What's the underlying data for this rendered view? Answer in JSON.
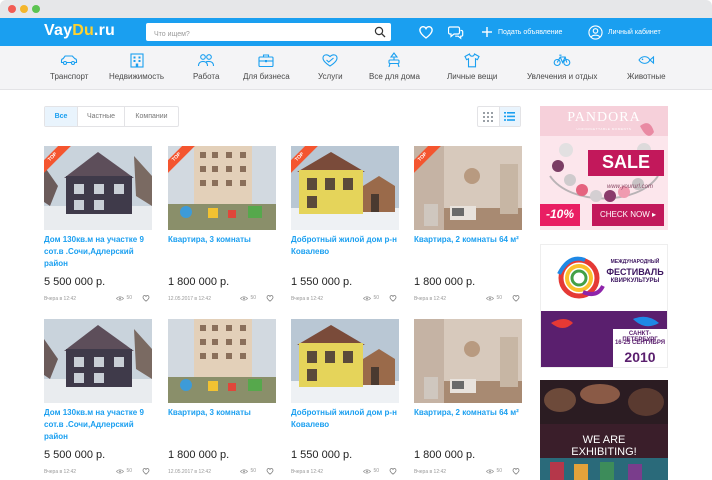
{
  "header": {
    "logo_a": "Vay",
    "logo_b": "Du",
    "logo_c": ".ru",
    "search_placeholder": "Что ищем?",
    "post_ad": "Подать объявление",
    "account": "Личный кабинет"
  },
  "categories": [
    {
      "label": "Транспорт",
      "icon": "car-icon"
    },
    {
      "label": "Недвижимость",
      "icon": "building-icon"
    },
    {
      "label": "Работа",
      "icon": "people-icon"
    },
    {
      "label": "Для бизнеса",
      "icon": "briefcase-icon"
    },
    {
      "label": "Услуги",
      "icon": "handshake-icon"
    },
    {
      "label": "Все для дома",
      "icon": "lamp-chair-icon"
    },
    {
      "label": "Личные вещи",
      "icon": "tshirt-icon"
    },
    {
      "label": "Увлечения и отдых",
      "icon": "bicycle-icon"
    },
    {
      "label": "Животные",
      "icon": "fish-icon"
    }
  ],
  "filters": [
    "Все",
    "Частные",
    "Компании"
  ],
  "listings": [
    {
      "title": "Дом 130кв.м на участке 9 сот.в .Сочи,Адлерский район",
      "price": "5 500 000 р.",
      "date": "Вчера в 12:42",
      "views": "50",
      "top": "TOP",
      "photo": "house"
    },
    {
      "title": "Квартира, 3 комнаты",
      "price": "1 800 000 р.",
      "date": "12.05.2017 в 12:42",
      "views": "50",
      "top": "TOP",
      "photo": "block"
    },
    {
      "title": "Добротный жилой дом р-н Ковалево",
      "price": "1 550 000 р.",
      "date": "Вчера в 12:42",
      "views": "50",
      "top": "TOP",
      "photo": "yellow"
    },
    {
      "title": "Квартира, 2 комнаты 64 м²",
      "price": "1 800 000 р.",
      "date": "Вчера в 12:42",
      "views": "50",
      "top": "TOP",
      "photo": "room"
    },
    {
      "title": "Дом 130кв.м на участке 9 сот.в .Сочи,Адлерский район",
      "price": "5 500 000 р.",
      "date": "Вчера в 12:42",
      "views": "50",
      "top": "",
      "photo": "house"
    },
    {
      "title": "Квартира, 3 комнаты",
      "price": "1 800 000 р.",
      "date": "12.05.2017 в 12:42",
      "views": "50",
      "top": "",
      "photo": "block"
    },
    {
      "title": "Добротный жилой дом р-н Ковалево",
      "price": "1 550 000 р.",
      "date": "Вчера в 12:42",
      "views": "50",
      "top": "",
      "photo": "yellow"
    },
    {
      "title": "Квартира, 2 комнаты 64 м²",
      "price": "1 800 000 р.",
      "date": "Вчера в 12:42",
      "views": "50",
      "top": "",
      "photo": "room"
    }
  ],
  "ads": {
    "pandora": {
      "brand": "PANDORA",
      "tagline": "UNFORGETTABLE MOMENTS",
      "sale": "SALE",
      "url": "www.yourur!.com",
      "discount": "-10%",
      "cta": "CHECK NOW ▸"
    },
    "festival": {
      "line1": "МЕЖДУНАРОДНЫЙ",
      "line2": "ФЕСТИВАЛЬ",
      "line3": "КВИРКУЛЬТУРЫ",
      "city": "САНКТ-ПЕТЕРБУРГ",
      "dates": "16-25 СЕНТЯБРЯ",
      "year": "2010"
    },
    "exhibit": {
      "line1": "WE ARE",
      "line2": "EXHIBITING!"
    }
  },
  "colors": {
    "brand_blue": "#1a9ff0",
    "logo_yellow": "#ffd22e",
    "top_badge": "#f4552f",
    "page_bg": "#ffffff"
  }
}
